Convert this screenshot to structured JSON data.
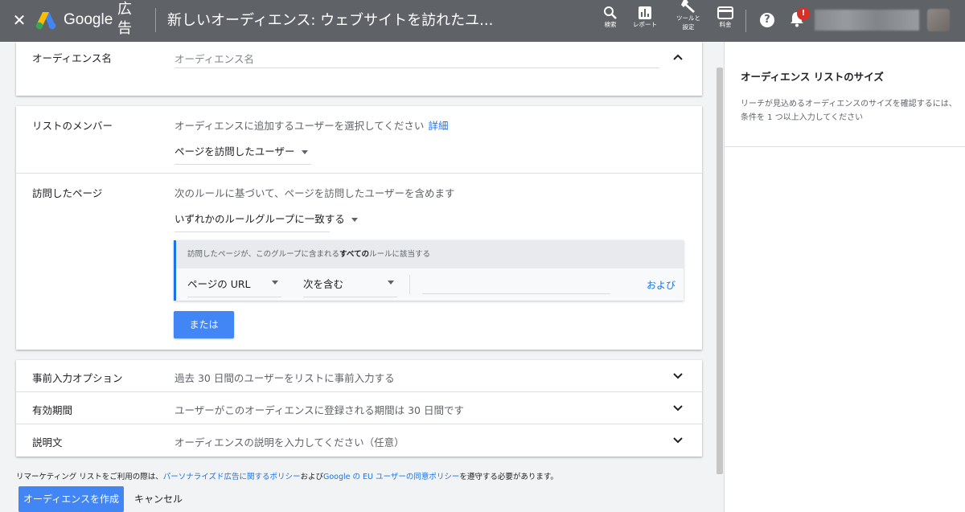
{
  "topbar": {
    "close_icon": "close-icon",
    "logo_text": "Google",
    "logo_sub": "広告",
    "page_title": "新しいオーディエンス: ウェブサイトを訪れたユ...",
    "nav": [
      {
        "icon": "search-icon",
        "label": "検索"
      },
      {
        "icon": "report-icon",
        "label": "レポート"
      },
      {
        "icon": "wrench-icon",
        "label": "ツールと\n設定"
      },
      {
        "icon": "billing-icon",
        "label": "料金"
      }
    ],
    "help_icon": "help-icon",
    "notification_icon": "bell-icon",
    "notification_badge": "!"
  },
  "audience_name": {
    "label": "オーディエンス名",
    "placeholder": "オーディエンス名"
  },
  "list_members": {
    "label": "リストのメンバー",
    "hint": "オーディエンスに追加するユーザーを選択してください",
    "hint_link": "詳細",
    "selected": "ページを訪問したユーザー"
  },
  "visited_pages": {
    "label": "訪問したページ",
    "hint": "次のルールに基づいて、ページを訪問したユーザーを含めます",
    "match_selected": "いずれかのルールグループに一致する",
    "rule_group": {
      "header_prefix": "訪問したページが、このグループに含まれる",
      "header_bold": "すべての",
      "header_suffix": "ルールに該当する",
      "field": "ページの URL",
      "operator": "次を含む",
      "value": "",
      "and_link": "および"
    },
    "or_button": "または"
  },
  "options": [
    {
      "label": "事前入力オプション",
      "value": "過去 30 日間のユーザーをリストに事前入力する"
    },
    {
      "label": "有効期間",
      "value": "ユーザーがこのオーディエンスに登録される期間は 30 日間です"
    },
    {
      "label": "説明文",
      "value": "オーディエンスの説明を入力してください（任意）"
    }
  ],
  "policy": {
    "prefix": "リマーケティング リストをご利用の際は、",
    "link1": "パーソナライズド広告に関するポリシー",
    "middle": "および",
    "link2": "Google の EU ユーザーの同意ポリシー",
    "suffix": "を遵守する必要があります。"
  },
  "actions": {
    "create": "オーディエンスを作成",
    "cancel": "キャンセル"
  },
  "side_panel": {
    "title": "オーディエンス リストのサイズ",
    "description": "リーチが見込めるオーディエンスのサイズを確認するには、条件を 1 つ以上入力してください"
  },
  "colors": {
    "topbar": "#5f6368",
    "primary_button": "#4285f4",
    "link": "#1a73e8",
    "badge": "#d93025"
  }
}
